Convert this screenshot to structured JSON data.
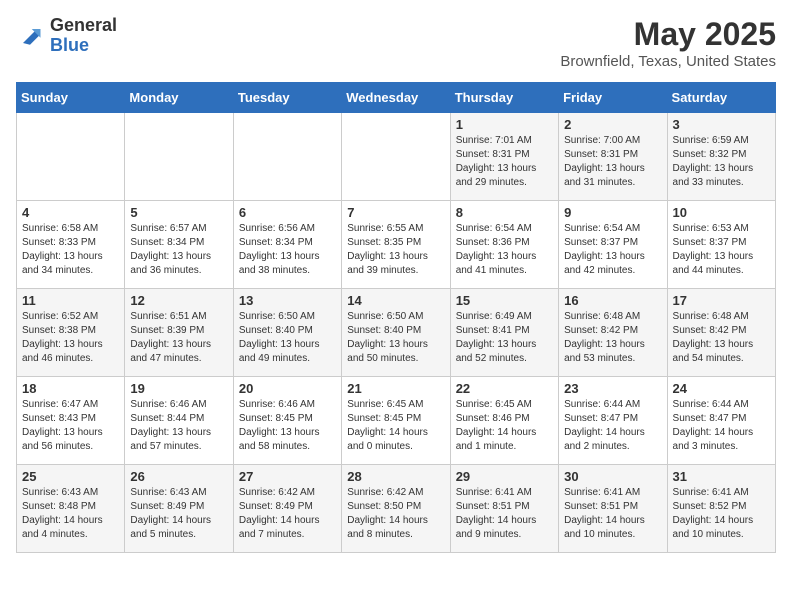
{
  "logo": {
    "general": "General",
    "blue": "Blue"
  },
  "title": {
    "month": "May 2025",
    "location": "Brownfield, Texas, United States"
  },
  "days_of_week": [
    "Sunday",
    "Monday",
    "Tuesday",
    "Wednesday",
    "Thursday",
    "Friday",
    "Saturday"
  ],
  "weeks": [
    [
      {
        "day": "",
        "info": ""
      },
      {
        "day": "",
        "info": ""
      },
      {
        "day": "",
        "info": ""
      },
      {
        "day": "",
        "info": ""
      },
      {
        "day": "1",
        "info": "Sunrise: 7:01 AM\nSunset: 8:31 PM\nDaylight: 13 hours\nand 29 minutes."
      },
      {
        "day": "2",
        "info": "Sunrise: 7:00 AM\nSunset: 8:31 PM\nDaylight: 13 hours\nand 31 minutes."
      },
      {
        "day": "3",
        "info": "Sunrise: 6:59 AM\nSunset: 8:32 PM\nDaylight: 13 hours\nand 33 minutes."
      }
    ],
    [
      {
        "day": "4",
        "info": "Sunrise: 6:58 AM\nSunset: 8:33 PM\nDaylight: 13 hours\nand 34 minutes."
      },
      {
        "day": "5",
        "info": "Sunrise: 6:57 AM\nSunset: 8:34 PM\nDaylight: 13 hours\nand 36 minutes."
      },
      {
        "day": "6",
        "info": "Sunrise: 6:56 AM\nSunset: 8:34 PM\nDaylight: 13 hours\nand 38 minutes."
      },
      {
        "day": "7",
        "info": "Sunrise: 6:55 AM\nSunset: 8:35 PM\nDaylight: 13 hours\nand 39 minutes."
      },
      {
        "day": "8",
        "info": "Sunrise: 6:54 AM\nSunset: 8:36 PM\nDaylight: 13 hours\nand 41 minutes."
      },
      {
        "day": "9",
        "info": "Sunrise: 6:54 AM\nSunset: 8:37 PM\nDaylight: 13 hours\nand 42 minutes."
      },
      {
        "day": "10",
        "info": "Sunrise: 6:53 AM\nSunset: 8:37 PM\nDaylight: 13 hours\nand 44 minutes."
      }
    ],
    [
      {
        "day": "11",
        "info": "Sunrise: 6:52 AM\nSunset: 8:38 PM\nDaylight: 13 hours\nand 46 minutes."
      },
      {
        "day": "12",
        "info": "Sunrise: 6:51 AM\nSunset: 8:39 PM\nDaylight: 13 hours\nand 47 minutes."
      },
      {
        "day": "13",
        "info": "Sunrise: 6:50 AM\nSunset: 8:40 PM\nDaylight: 13 hours\nand 49 minutes."
      },
      {
        "day": "14",
        "info": "Sunrise: 6:50 AM\nSunset: 8:40 PM\nDaylight: 13 hours\nand 50 minutes."
      },
      {
        "day": "15",
        "info": "Sunrise: 6:49 AM\nSunset: 8:41 PM\nDaylight: 13 hours\nand 52 minutes."
      },
      {
        "day": "16",
        "info": "Sunrise: 6:48 AM\nSunset: 8:42 PM\nDaylight: 13 hours\nand 53 minutes."
      },
      {
        "day": "17",
        "info": "Sunrise: 6:48 AM\nSunset: 8:42 PM\nDaylight: 13 hours\nand 54 minutes."
      }
    ],
    [
      {
        "day": "18",
        "info": "Sunrise: 6:47 AM\nSunset: 8:43 PM\nDaylight: 13 hours\nand 56 minutes."
      },
      {
        "day": "19",
        "info": "Sunrise: 6:46 AM\nSunset: 8:44 PM\nDaylight: 13 hours\nand 57 minutes."
      },
      {
        "day": "20",
        "info": "Sunrise: 6:46 AM\nSunset: 8:45 PM\nDaylight: 13 hours\nand 58 minutes."
      },
      {
        "day": "21",
        "info": "Sunrise: 6:45 AM\nSunset: 8:45 PM\nDaylight: 14 hours\nand 0 minutes."
      },
      {
        "day": "22",
        "info": "Sunrise: 6:45 AM\nSunset: 8:46 PM\nDaylight: 14 hours\nand 1 minute."
      },
      {
        "day": "23",
        "info": "Sunrise: 6:44 AM\nSunset: 8:47 PM\nDaylight: 14 hours\nand 2 minutes."
      },
      {
        "day": "24",
        "info": "Sunrise: 6:44 AM\nSunset: 8:47 PM\nDaylight: 14 hours\nand 3 minutes."
      }
    ],
    [
      {
        "day": "25",
        "info": "Sunrise: 6:43 AM\nSunset: 8:48 PM\nDaylight: 14 hours\nand 4 minutes."
      },
      {
        "day": "26",
        "info": "Sunrise: 6:43 AM\nSunset: 8:49 PM\nDaylight: 14 hours\nand 5 minutes."
      },
      {
        "day": "27",
        "info": "Sunrise: 6:42 AM\nSunset: 8:49 PM\nDaylight: 14 hours\nand 7 minutes."
      },
      {
        "day": "28",
        "info": "Sunrise: 6:42 AM\nSunset: 8:50 PM\nDaylight: 14 hours\nand 8 minutes."
      },
      {
        "day": "29",
        "info": "Sunrise: 6:41 AM\nSunset: 8:51 PM\nDaylight: 14 hours\nand 9 minutes."
      },
      {
        "day": "30",
        "info": "Sunrise: 6:41 AM\nSunset: 8:51 PM\nDaylight: 14 hours\nand 10 minutes."
      },
      {
        "day": "31",
        "info": "Sunrise: 6:41 AM\nSunset: 8:52 PM\nDaylight: 14 hours\nand 10 minutes."
      }
    ]
  ]
}
